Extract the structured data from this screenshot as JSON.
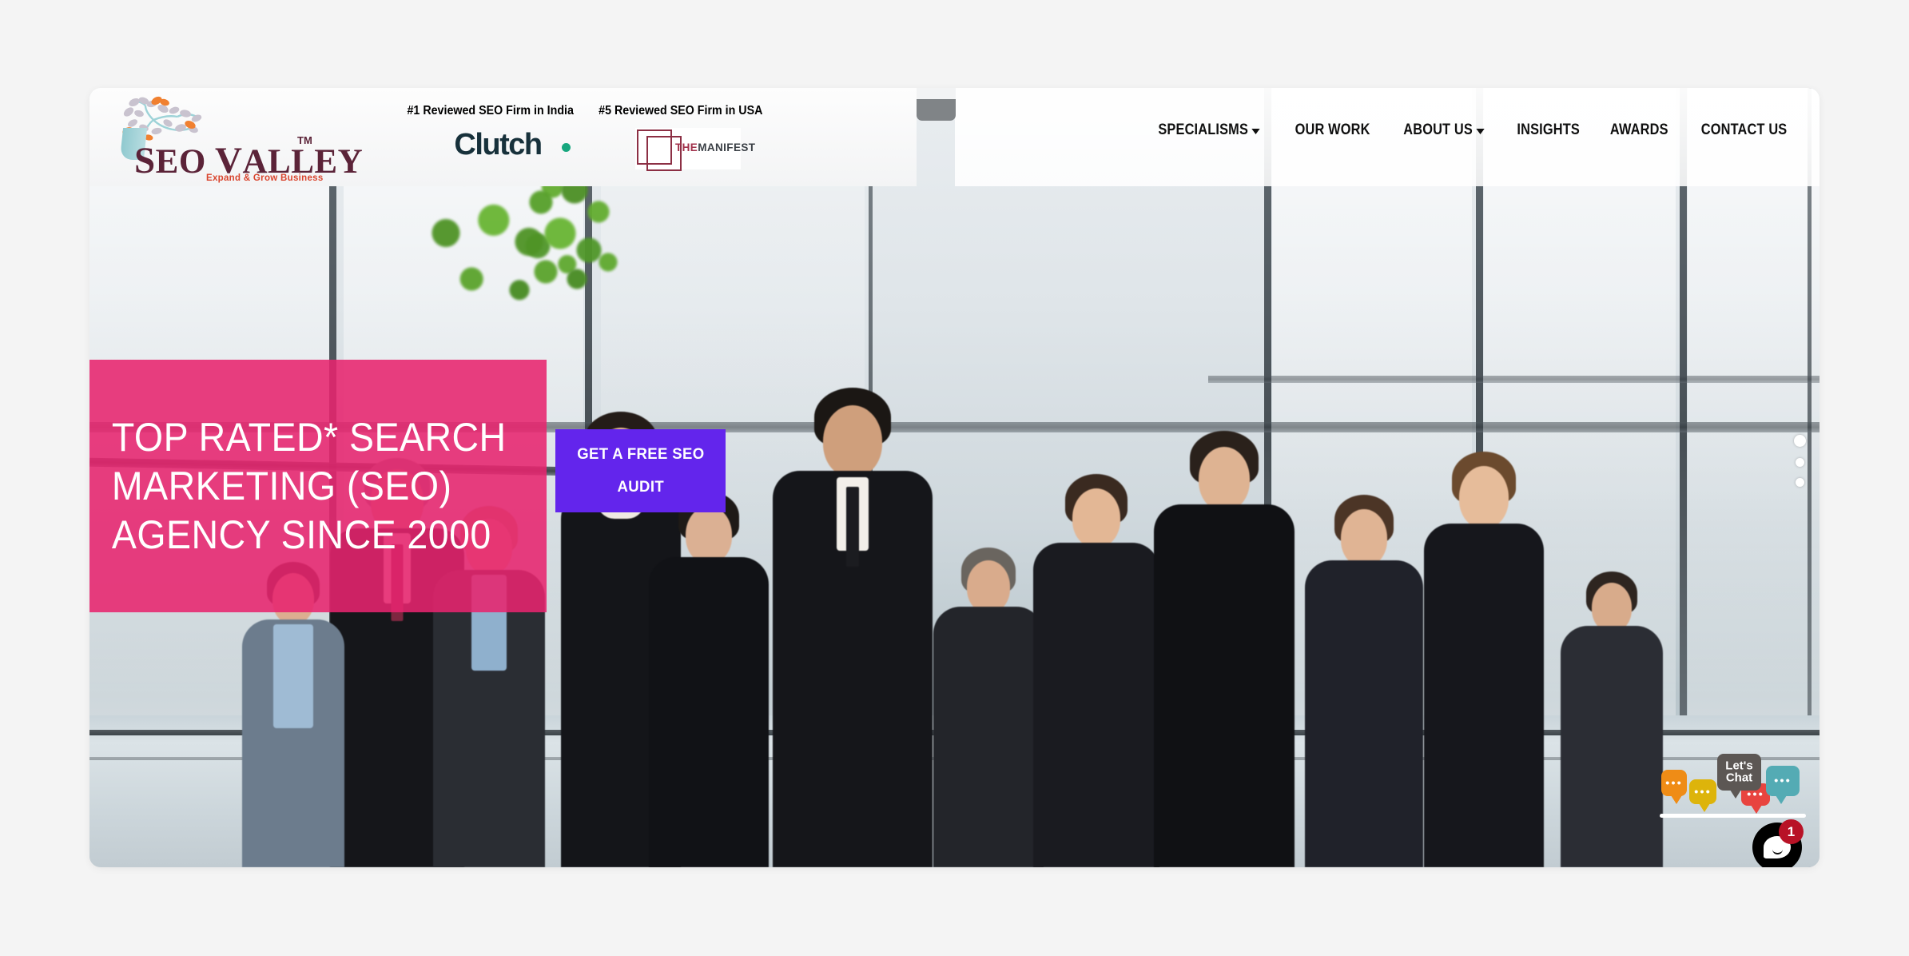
{
  "site": {
    "brand": {
      "name_seo": "SEO",
      "name_valley": "VALLEY",
      "trademark": "TM",
      "tagline": "Expand & Grow Business",
      "logo_icon": "tree-logo"
    },
    "badges": [
      {
        "text": "#1 Reviewed SEO Firm in India",
        "logo_name": "clutch-logo",
        "logo_label": "Clutch"
      },
      {
        "text": "#5 Reviewed SEO Firm in USA",
        "logo_name": "the-manifest-logo",
        "logo_label_the": "THE",
        "logo_label_manifest": "MANIFEST"
      }
    ],
    "nav": [
      {
        "label": "SPECIALISMS",
        "has_dropdown": true
      },
      {
        "label": "OUR WORK",
        "has_dropdown": false
      },
      {
        "label": "ABOUT US",
        "has_dropdown": true
      },
      {
        "label": "INSIGHTS",
        "has_dropdown": false
      },
      {
        "label": "AWARDS",
        "has_dropdown": false
      },
      {
        "label": "CONTACT US",
        "has_dropdown": false
      }
    ]
  },
  "hero": {
    "headline": "TOP RATED* SEARCH\nMARKETING (SEO)\nAGENCY SINCE 2000",
    "cta_line1": "GET A FREE SEO",
    "cta_line2": "AUDIT",
    "panel_color": "#e7246e",
    "cta_color": "#6325ec",
    "slides": [
      "1",
      "2",
      "3"
    ],
    "active_slide": "1"
  },
  "chat": {
    "label": "Let's\nChat",
    "bubble_dots": "•••",
    "unread_count": "1",
    "fab_icon": "chat-bubble-icon"
  },
  "colors": {
    "pink": "#e7246e",
    "purple": "#6325ec",
    "brand_maroon": "#5b2338",
    "brand_orange": "#d9452e",
    "clutch_navy": "#17313b",
    "clutch_green": "#17a77e",
    "manifest_maroon": "#8c2f44",
    "page_bg": "#f4f4f4"
  }
}
